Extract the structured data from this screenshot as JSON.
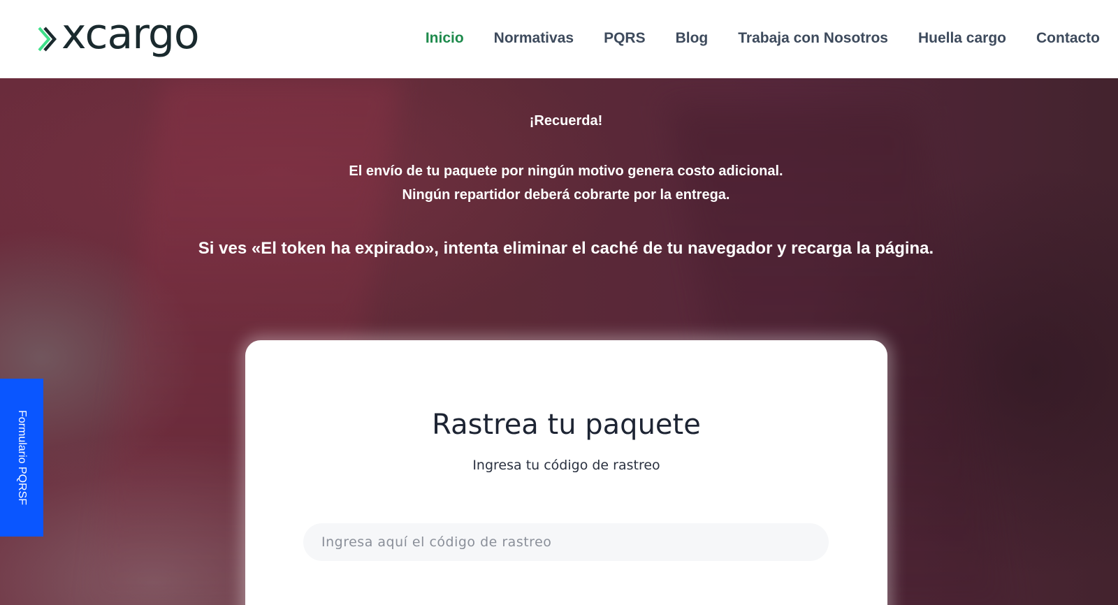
{
  "header": {
    "logo_text": "xcargo",
    "nav": [
      {
        "label": "Inicio",
        "active": true
      },
      {
        "label": "Normativas",
        "active": false
      },
      {
        "label": "PQRS",
        "active": false
      },
      {
        "label": "Blog",
        "active": false
      },
      {
        "label": "Trabaja con Nosotros",
        "active": false
      },
      {
        "label": "Huella cargo",
        "active": false
      },
      {
        "label": "Contacto",
        "active": false
      }
    ]
  },
  "hero": {
    "reminder_title": "¡Recuerda!",
    "notice_line_1": "El envío de tu paquete por ningún motivo genera costo adicional.",
    "notice_line_2": "Ningún repartidor deberá cobrarte por la entrega.",
    "token_notice": "Si ves «El token ha expirado», intenta eliminar el caché de tu navegador y recarga la página."
  },
  "tracking": {
    "title": "Rastrea tu paquete",
    "subtitle": "Ingresa tu código de rastreo",
    "input_placeholder": "Ingresa aquí el código de rastreo",
    "input_value": ""
  },
  "side_tab": {
    "label": "Formulario PQRSF"
  },
  "colors": {
    "nav_active": "#1e8a4c",
    "nav_default": "#3d4a5c",
    "side_tab": "#0a56ff",
    "logo_accent": "#3fe08a"
  }
}
